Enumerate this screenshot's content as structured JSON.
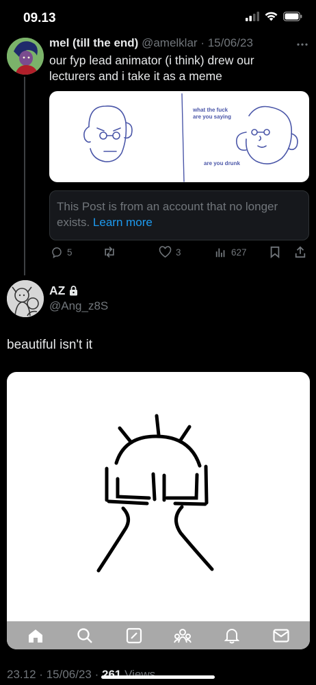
{
  "status_bar": {
    "time": "09.13"
  },
  "post1": {
    "display_name": "mel (till the end)",
    "handle": "@amelklar",
    "separator": "·",
    "date": "15/06/23",
    "text": "our fyp lead animator (i think) drew our lecturers and i take it as a meme",
    "image": {
      "caption_top": "what the fuck are you saying",
      "caption_bottom": "are you drunk"
    },
    "unavailable_notice": "This Post is from an account that no longer exists.",
    "learn_more": "Learn more",
    "actions": {
      "replies": "5",
      "reposts": "",
      "likes": "3",
      "views": "627"
    }
  },
  "post2": {
    "display_name": "AZ",
    "handle": "@Ang_z8S",
    "text": "beautiful isn't it",
    "footer_time": "23.12",
    "footer_date": "15/06/23",
    "footer_sep": "·",
    "footer_views_count": "261",
    "footer_views_label": "Views"
  },
  "tab_bar": {
    "tabs": [
      "home-icon",
      "search-icon",
      "compose-icon",
      "communities-icon",
      "notifications-icon",
      "messages-icon"
    ]
  },
  "colors": {
    "background": "#000000",
    "accent": "#1d9bf0",
    "muted": "#71767b",
    "sketch_blue": "#4a56a8"
  }
}
